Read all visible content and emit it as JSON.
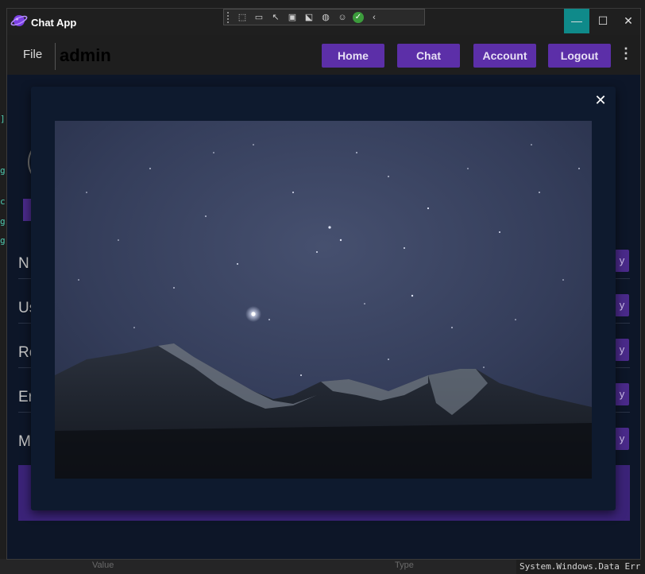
{
  "window": {
    "title": "Chat App",
    "controls": {
      "minimize": "—",
      "maximize": "☐",
      "close": "✕"
    }
  },
  "debug_toolbar": {
    "icons": [
      "grip-icon",
      "select-element-icon",
      "video-icon",
      "pointer-icon",
      "bounds-icon",
      "track-focus-icon",
      "binding-icon",
      "accessibility-icon",
      "check-icon",
      "collapse-icon"
    ]
  },
  "menu": {
    "file_label": "File"
  },
  "user": {
    "name": "admin"
  },
  "nav": {
    "home": "Home",
    "chat": "Chat",
    "account": "Account",
    "logout": "Logout",
    "more": "⋮"
  },
  "background_rows": {
    "labels": [
      "N",
      "Us",
      "Ro",
      "Er",
      "M"
    ],
    "button_text": "y"
  },
  "modal": {
    "close_label": "✕",
    "image_alt": "Starry night sky over snow-capped mountains"
  },
  "ide": {
    "columns": [
      "Value",
      "Type"
    ],
    "output": "System.Windows.Data Err"
  },
  "colors": {
    "accent": "#5c2fa8",
    "window_bg": "#0d1628",
    "minimize_bg": "#0f8a8a"
  }
}
